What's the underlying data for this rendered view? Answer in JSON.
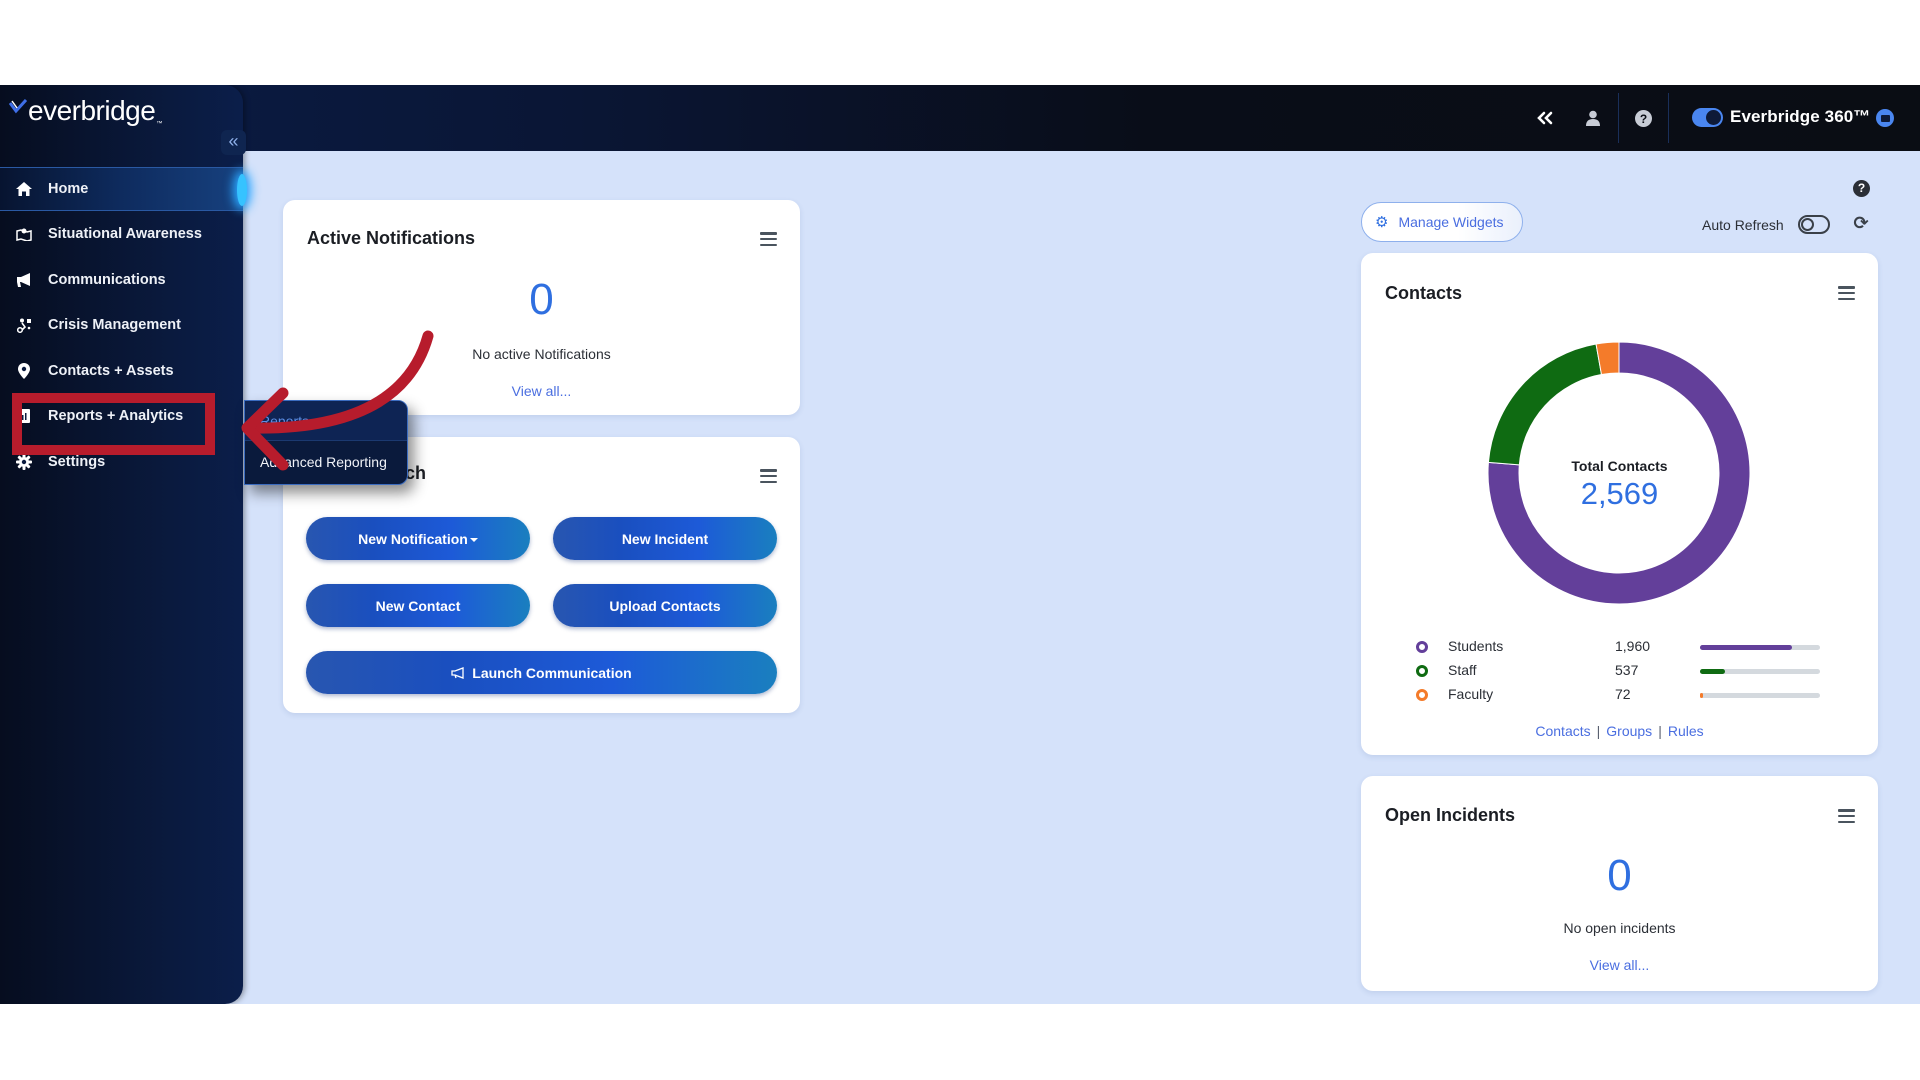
{
  "header": {
    "collapse_all_icon": "double-chevron-left-icon",
    "user_icon": "user-icon",
    "help_icon": "help-circle-icon",
    "brand_toggle_on": true,
    "brand_label": "Everbridge 360™",
    "chat_icon": "chat-icon"
  },
  "sidebar": {
    "logo_text": "everbridge",
    "collapse_label": "«",
    "items": [
      {
        "label": "Home",
        "icon": "home-icon",
        "active": true
      },
      {
        "label": "Situational Awareness",
        "icon": "map-icon",
        "active": false
      },
      {
        "label": "Communications",
        "icon": "megaphone-icon",
        "active": false
      },
      {
        "label": "Crisis Management",
        "icon": "route-icon",
        "active": false
      },
      {
        "label": "Contacts + Assets",
        "icon": "location-pin-icon",
        "active": false
      },
      {
        "label": "Reports + Analytics",
        "icon": "report-icon",
        "active": false
      },
      {
        "label": "Settings",
        "icon": "gear-icon",
        "active": false
      }
    ],
    "flyout": {
      "items": [
        {
          "label": "Reports"
        },
        {
          "label": "Advanced Reporting"
        }
      ]
    }
  },
  "toolbar": {
    "manage_widgets_label": "Manage Widgets",
    "auto_refresh_label": "Auto Refresh",
    "auto_refresh_on": false
  },
  "widgets": {
    "active_notifications": {
      "title": "Active Notifications",
      "count": "0",
      "message": "No active Notifications",
      "link": "View all..."
    },
    "quick_launch": {
      "title": "Quick Launch",
      "buttons": [
        {
          "label": "New Notification"
        },
        {
          "label": "New Incident"
        },
        {
          "label": "New Contact"
        },
        {
          "label": "Upload Contacts"
        },
        {
          "label": "Launch Communication"
        }
      ]
    },
    "contacts": {
      "title": "Contacts",
      "center_label": "Total Contacts",
      "total": "2,569",
      "links": [
        "Contacts",
        "Groups",
        "Rules"
      ]
    },
    "open_incidents": {
      "title": "Open Incidents",
      "count": "0",
      "message": "No open incidents",
      "link": "View all..."
    }
  },
  "chart_data": {
    "type": "pie",
    "title": "Contacts",
    "center_label": "Total Contacts",
    "total": 2569,
    "series": [
      {
        "name": "Students",
        "value": 1960,
        "display": "1,960",
        "color": "#633f9a"
      },
      {
        "name": "Staff",
        "value": 537,
        "display": "537",
        "color": "#0f6b12"
      },
      {
        "name": "Faculty",
        "value": 72,
        "display": "72",
        "color": "#f47b2a"
      }
    ],
    "legend": "bottom"
  },
  "colors": {
    "accent": "#2f6fe0",
    "link": "#4a6ee0",
    "annotation": "#b71c2c",
    "background": "#d5e2fa"
  }
}
